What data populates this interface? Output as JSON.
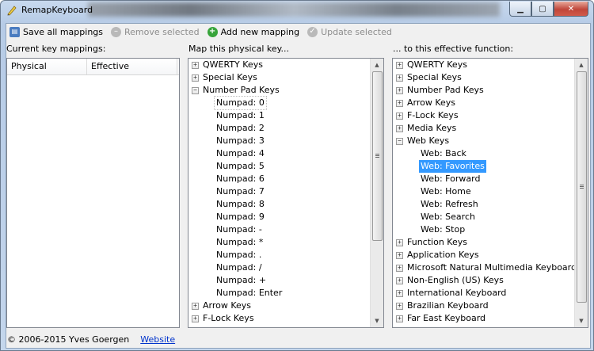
{
  "window": {
    "title": "RemapKeyboard"
  },
  "toolbar": {
    "save_label": "Save all mappings",
    "remove_label": "Remove selected",
    "add_label": "Add new mapping",
    "update_label": "Update selected"
  },
  "mappings": {
    "heading": "Current key mappings:",
    "columns": [
      "Physical",
      "Effective"
    ]
  },
  "physical": {
    "heading": "Map this physical key...",
    "groups": [
      "QWERTY Keys",
      "Special Keys",
      "Number Pad Keys"
    ],
    "children": [
      "Numpad: 0",
      "Numpad: 1",
      "Numpad: 2",
      "Numpad: 3",
      "Numpad: 4",
      "Numpad: 5",
      "Numpad: 6",
      "Numpad: 7",
      "Numpad: 8",
      "Numpad: 9",
      "Numpad: -",
      "Numpad: *",
      "Numpad: .",
      "Numpad: /",
      "Numpad: +",
      "Numpad: Enter"
    ],
    "after_groups": [
      "Arrow Keys",
      "F-Lock Keys"
    ]
  },
  "effective": {
    "heading": "... to this effective function:",
    "groups_before": [
      "QWERTY Keys",
      "Special Keys",
      "Number Pad Keys",
      "Arrow Keys",
      "F-Lock Keys",
      "Media Keys",
      "Web Keys"
    ],
    "children": [
      "Web: Back",
      "Web: Favorites",
      "Web: Forward",
      "Web: Home",
      "Web: Refresh",
      "Web: Search",
      "Web: Stop"
    ],
    "selected": "Web: Favorites",
    "groups_after": [
      "Function Keys",
      "Application Keys",
      "Microsoft Natural Multimedia Keyboard",
      "Non-English (US) Keys",
      "International Keyboard",
      "Brazilian Keyboard",
      "Far East Keyboard"
    ]
  },
  "footer": {
    "copyright": "© 2006-2015 Yves Goergen",
    "link": "Website"
  },
  "colors": {
    "selection": "#3399ff",
    "link": "#0033cc",
    "add_icon": "#37a43a"
  }
}
